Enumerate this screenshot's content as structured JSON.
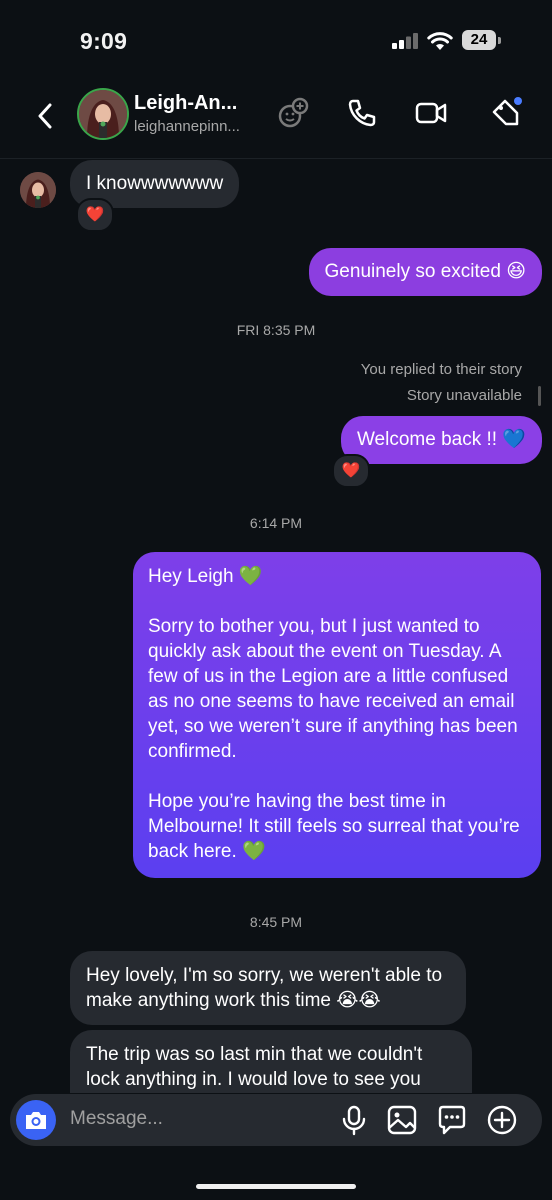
{
  "status": {
    "time": "9:09",
    "battery": "24"
  },
  "header": {
    "name": "Leigh-An...",
    "username": "leighannepinn..."
  },
  "messages": {
    "m1": {
      "text": "I knowwwwwww",
      "reaction": "❤️"
    },
    "m2": {
      "text": "Genuinely so excited 😆"
    },
    "t1": "FRI 8:35 PM",
    "story_reply": "You replied to their story",
    "story_unavailable": "Story unavailable",
    "m3": {
      "text": "Welcome back !! 💙",
      "reaction": "❤️"
    },
    "t2": "6:14 PM",
    "m4": {
      "p1": "Hey Leigh 💚",
      "p2": "Sorry to bother you, but I just wanted to quickly ask about the event on Tuesday. A few of us in the Legion are a little confused as no one seems to have received an email yet, so we weren’t sure if anything has been confirmed.",
      "p3": "Hope you’re having the best time in Melbourne! It still feels so surreal that you’re back here. 💚"
    },
    "t3": "8:45 PM",
    "m5": {
      "text": "Hey lovely, I'm so sorry, we weren't able to make anything work this time 😭😭"
    },
    "m6": {
      "text": "The trip was so last min that we couldn't lock anything in. I would love to see you"
    }
  },
  "composer": {
    "placeholder": "Message..."
  },
  "colors": {
    "outgoing": "#8a3fe0",
    "outgoing_gradient_end": "#5b3ff0",
    "incoming": "#262a30",
    "background": "#0c1014",
    "camera": "#3a63f4"
  }
}
